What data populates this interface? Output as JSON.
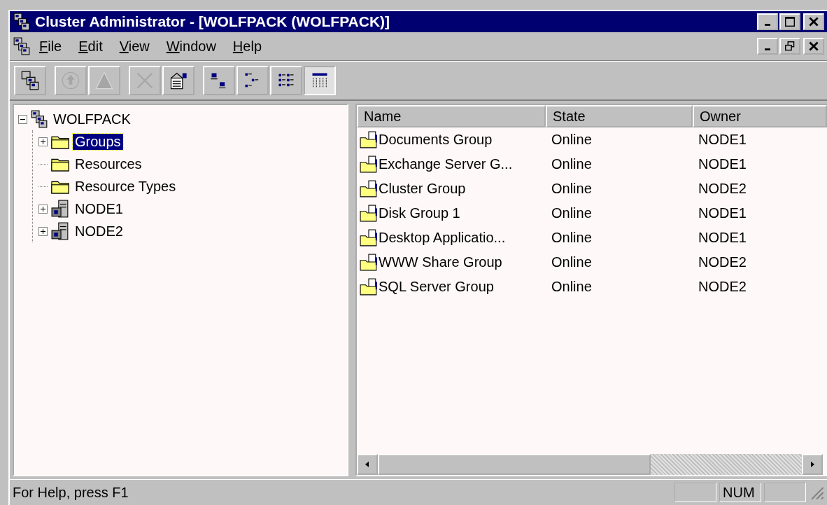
{
  "window": {
    "title": "Cluster Administrator - [WOLFPACK (WOLFPACK)]"
  },
  "menu": [
    {
      "label": "File"
    },
    {
      "label": "Edit"
    },
    {
      "label": "View"
    },
    {
      "label": "Window"
    },
    {
      "label": "Help"
    }
  ],
  "toolbar": [
    [
      {
        "kind": "cluster",
        "disabled": false,
        "pressed": false
      }
    ],
    [
      {
        "kind": "online",
        "disabled": true,
        "pressed": false
      },
      {
        "kind": "offline",
        "disabled": true,
        "pressed": false
      }
    ],
    [
      {
        "kind": "delete",
        "disabled": true,
        "pressed": false
      },
      {
        "kind": "properties",
        "disabled": false,
        "pressed": false
      }
    ],
    [
      {
        "kind": "largeicons",
        "disabled": false,
        "pressed": false
      },
      {
        "kind": "smallicons",
        "disabled": false,
        "pressed": false
      },
      {
        "kind": "list",
        "disabled": false,
        "pressed": false
      },
      {
        "kind": "details",
        "disabled": false,
        "pressed": true
      }
    ]
  ],
  "tree": [
    {
      "label": "WOLFPACK",
      "kind": "cluster",
      "expanded": true,
      "selected": false,
      "children": [
        {
          "label": "Groups",
          "kind": "folder",
          "expanded": false,
          "selected": true
        },
        {
          "label": "Resources",
          "kind": "folder",
          "selected": false
        },
        {
          "label": "Resource Types",
          "kind": "folder",
          "selected": false
        },
        {
          "label": "NODE1",
          "kind": "node",
          "expanded": false,
          "selected": false
        },
        {
          "label": "NODE2",
          "kind": "node",
          "expanded": false,
          "selected": false
        }
      ]
    }
  ],
  "table": {
    "columns": [
      "Name",
      "State",
      "Owner"
    ],
    "rows": [
      [
        "Documents Group",
        "Online",
        "NODE1"
      ],
      [
        "Exchange Server G...",
        "Online",
        "NODE1"
      ],
      [
        "Cluster Group",
        "Online",
        "NODE2"
      ],
      [
        "Disk Group 1",
        "Online",
        "NODE1"
      ],
      [
        "Desktop Applicatio...",
        "Online",
        "NODE1"
      ],
      [
        "WWW Share Group",
        "Online",
        "NODE2"
      ],
      [
        "SQL Server Group",
        "Online",
        "NODE2"
      ]
    ]
  },
  "status_bar": {
    "text": "For Help, press F1",
    "panels": [
      {
        "kind": "blank"
      },
      {
        "kind": "text",
        "text": "NUM"
      },
      {
        "kind": "blank"
      }
    ]
  }
}
